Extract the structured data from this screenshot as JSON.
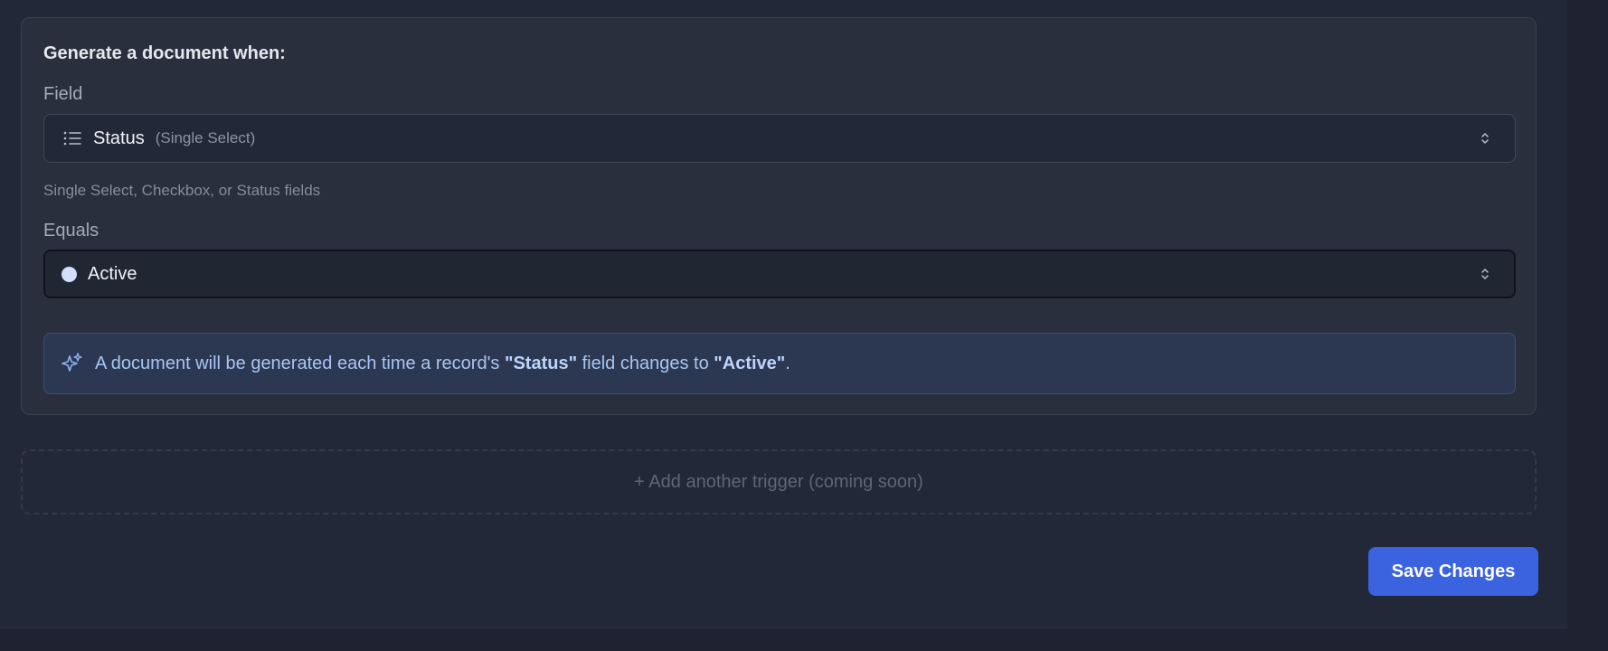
{
  "trigger": {
    "title": "Generate a document when:",
    "field": {
      "label": "Field",
      "selected_value": "Status",
      "selected_type": "(Single Select)",
      "helper": "Single Select, Checkbox, or Status fields",
      "icon": "list-icon"
    },
    "equals": {
      "label": "Equals",
      "selected_value": "Active",
      "dot_color": "#d3defa"
    },
    "info": {
      "text_prefix": "A document will be generated each time a record's ",
      "field_name": "\"Status\"",
      "text_middle": " field changes to ",
      "value_name": "\"Active\"",
      "text_suffix": ".",
      "icon": "sparkle-icon"
    }
  },
  "add_trigger_label": "+ Add another trigger (coming soon)",
  "save_button_label": "Save Changes",
  "colors": {
    "accent": "#3b63e0",
    "info_text": "#a9c5f3",
    "background": "#1f2331",
    "card": "#2a2f3e"
  }
}
